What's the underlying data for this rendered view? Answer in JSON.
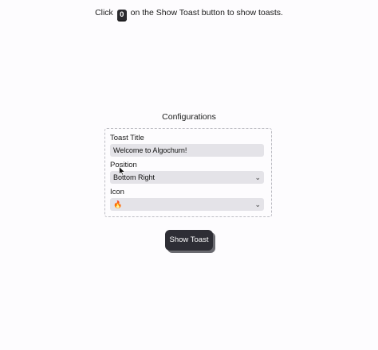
{
  "instruction": {
    "prefix": "Click",
    "key": "0",
    "suffix": "on the Show Toast button to show toasts."
  },
  "config": {
    "title": "Configurations",
    "toast_title_label": "Toast Title",
    "toast_title_value": "Welcome to Algochurn!",
    "position_label": "Position",
    "position_value": "Bottom Right",
    "icon_label": "Icon",
    "icon_value": "🔥"
  },
  "button": {
    "show_toast_label": "Show Toast"
  }
}
